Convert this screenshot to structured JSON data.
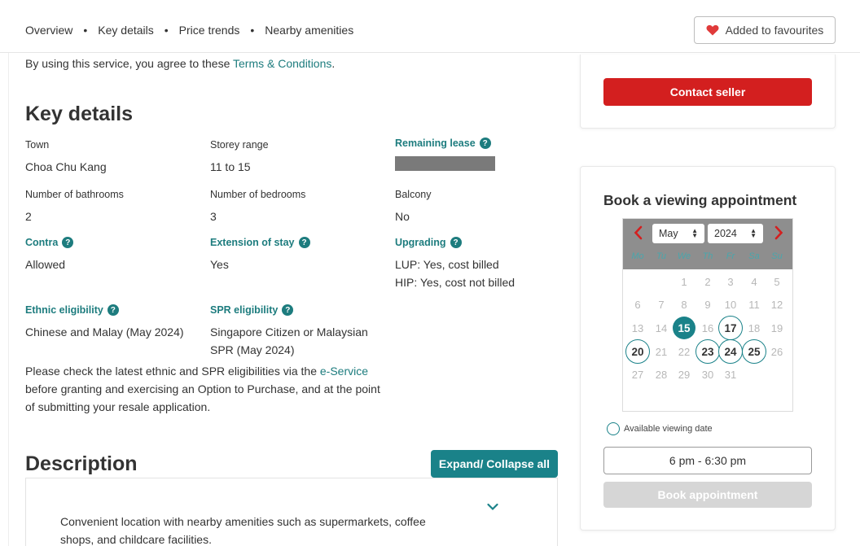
{
  "nav": {
    "items": [
      {
        "label": "Overview"
      },
      {
        "label": "Key details"
      },
      {
        "label": "Price trends"
      },
      {
        "label": "Nearby amenities"
      }
    ],
    "separator": "•",
    "favourite_label": "Added to favourites",
    "favourite_icon": "heart-icon",
    "favourite_color": "#e03a3a"
  },
  "terms": {
    "prefix": "By using this service, you agree to these ",
    "link": "Terms & Conditions",
    "suffix": "."
  },
  "key_details": {
    "title": "Key details",
    "fields": {
      "town": {
        "label": "Town",
        "value": "Choa Chu Kang"
      },
      "storey": {
        "label": "Storey range",
        "value": "11 to 15"
      },
      "lease": {
        "label": "Remaining lease",
        "value": ""
      },
      "bathrooms": {
        "label": "Number of bathrooms",
        "value": "2"
      },
      "bedrooms": {
        "label": "Number of bedrooms",
        "value": "3"
      },
      "balcony": {
        "label": "Balcony",
        "value": "No"
      },
      "contra": {
        "label": "Contra",
        "value": "Allowed"
      },
      "extension": {
        "label": "Extension of stay",
        "value": "Yes"
      },
      "upgrading": {
        "label": "Upgrading",
        "value_line1": "LUP: Yes, cost billed",
        "value_line2": "HIP: Yes, cost not billed"
      },
      "ethnic": {
        "label": "Ethnic eligibility",
        "value": "Chinese and Malay (May 2024)"
      },
      "spr": {
        "label": "SPR eligibility",
        "value_line1": "Singapore Citizen or Malaysian",
        "value_line2": "SPR (May 2024)"
      }
    },
    "note": {
      "prefix": "Please check the latest ethnic and SPR eligibilities via the ",
      "link": "e-Service",
      "suffix": " before granting and exercising an Option to Purchase, and at the point of submitting your resale application."
    }
  },
  "description": {
    "title": "Description",
    "expand_label": "Expand/ Collapse all",
    "text": "Convenient location with nearby amenities such as supermarkets, coffee shops, and childcare facilities."
  },
  "sidebar": {
    "contact_label": "Contact seller",
    "booking": {
      "title": "Book a viewing appointment",
      "month": "May",
      "year": "2024",
      "weekdays": [
        "Mo",
        "Tu",
        "We",
        "Th",
        "Fr",
        "Sa",
        "Su"
      ],
      "weeks": [
        [
          "",
          "",
          "1",
          "2",
          "3",
          "4",
          "5"
        ],
        [
          "6",
          "7",
          "8",
          "9",
          "10",
          "11",
          "12"
        ],
        [
          "13",
          "14",
          "15",
          "16",
          "17",
          "18",
          "19"
        ],
        [
          "20",
          "21",
          "22",
          "23",
          "24",
          "25",
          "26"
        ],
        [
          "27",
          "28",
          "29",
          "30",
          "31",
          "",
          ""
        ]
      ],
      "selected_day": "15",
      "available_days": [
        "17",
        "20",
        "23",
        "24",
        "25"
      ],
      "legend_label": "Available viewing date",
      "time_slot": "6 pm - 6:30 pm",
      "book_label": "Book appointment"
    }
  },
  "colors": {
    "accent": "#1a8289",
    "link": "#1d7c7e",
    "contact": "#d31f1f",
    "disabled": "#d6d6d6"
  }
}
